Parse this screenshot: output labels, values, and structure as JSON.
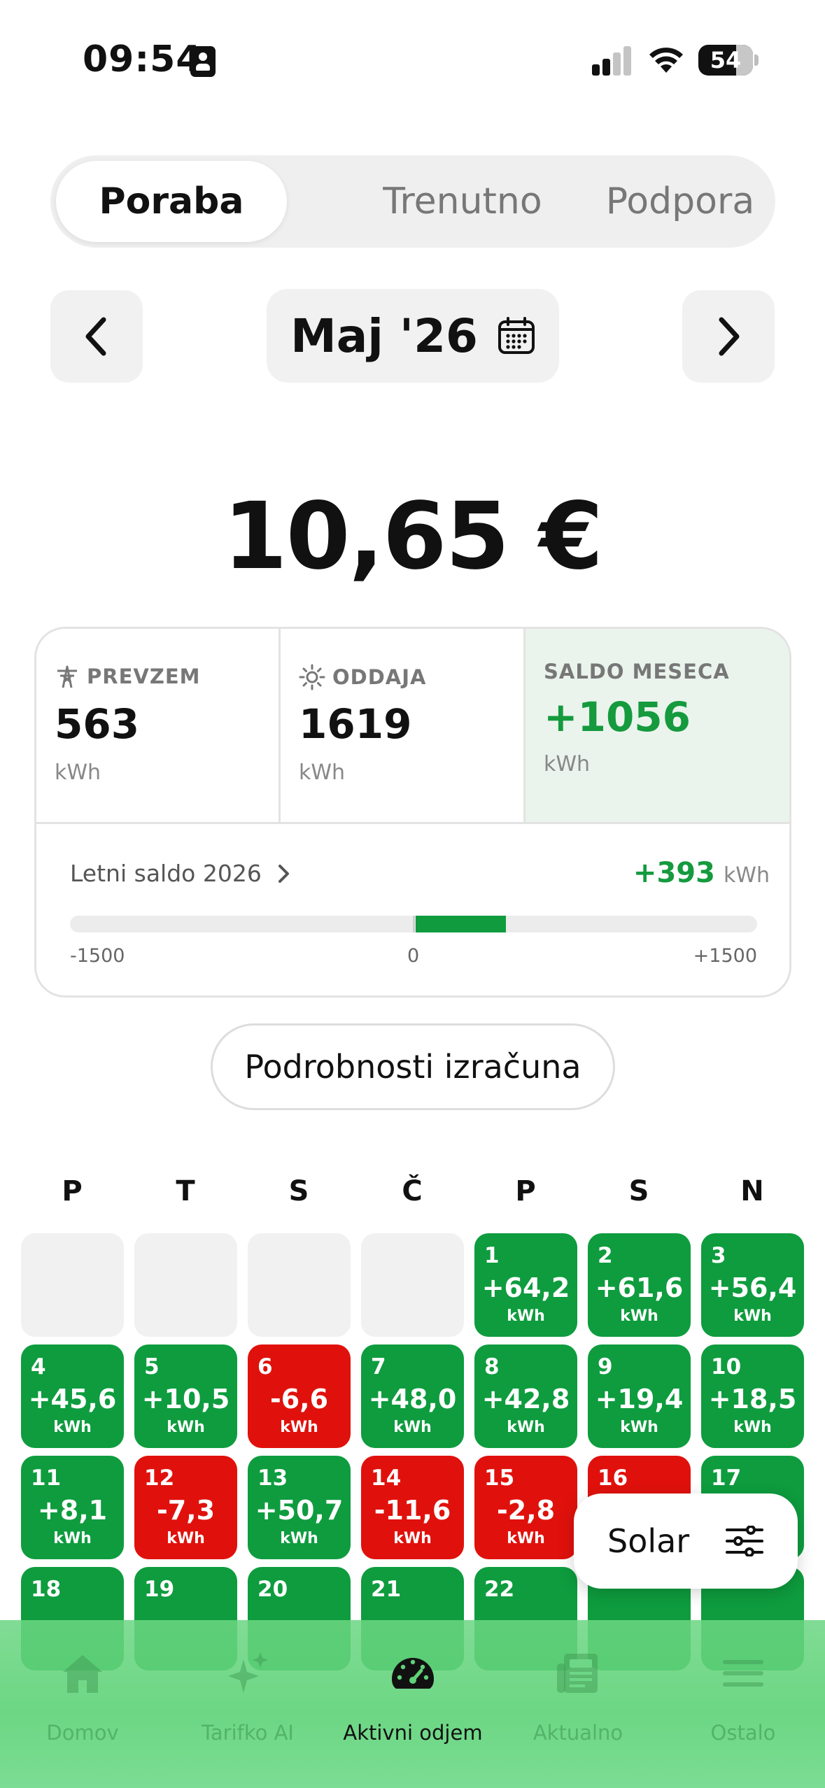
{
  "status_bar": {
    "time": "09:54",
    "battery": "54"
  },
  "tabs": [
    {
      "label": "Poraba",
      "active": true
    },
    {
      "label": "Trenutno",
      "active": false
    },
    {
      "label": "Podpora",
      "active": false
    }
  ],
  "period": {
    "label": "Maj '26"
  },
  "total": "10,65 €",
  "stats": {
    "prevzem": {
      "label": "PREVZEM",
      "value": "563",
      "unit": "kWh"
    },
    "oddaja": {
      "label": "ODDAJA",
      "value": "1619",
      "unit": "kWh"
    },
    "saldo": {
      "label": "SALDO MESECA",
      "value": "+1056",
      "unit": "kWh"
    }
  },
  "yearly": {
    "label": "Letni saldo 2026",
    "value": "+393",
    "unit": "kWh",
    "value_num": 393,
    "scale_min": -1500,
    "scale_max": 1500,
    "tick_min": "-1500",
    "tick_zero": "0",
    "tick_max": "+1500"
  },
  "details_button": "Podrobnosti izračuna",
  "calendar": {
    "weekdays": [
      "P",
      "T",
      "S",
      "Č",
      "P",
      "S",
      "N"
    ],
    "unit": "kWh",
    "days": [
      {
        "day": "1",
        "value": "+64,2",
        "type": "pos"
      },
      {
        "day": "2",
        "value": "+61,6",
        "type": "pos"
      },
      {
        "day": "3",
        "value": "+56,4",
        "type": "pos"
      },
      {
        "day": "4",
        "value": "+45,6",
        "type": "pos"
      },
      {
        "day": "5",
        "value": "+10,5",
        "type": "pos"
      },
      {
        "day": "6",
        "value": "-6,6",
        "type": "neg"
      },
      {
        "day": "7",
        "value": "+48,0",
        "type": "pos"
      },
      {
        "day": "8",
        "value": "+42,8",
        "type": "pos"
      },
      {
        "day": "9",
        "value": "+19,4",
        "type": "pos"
      },
      {
        "day": "10",
        "value": "+18,5",
        "type": "pos"
      },
      {
        "day": "11",
        "value": "+8,1",
        "type": "pos"
      },
      {
        "day": "12",
        "value": "-7,3",
        "type": "neg"
      },
      {
        "day": "13",
        "value": "+50,7",
        "type": "pos"
      },
      {
        "day": "14",
        "value": "-11,6",
        "type": "neg"
      },
      {
        "day": "15",
        "value": "-2,8",
        "type": "neg"
      },
      {
        "day": "16",
        "value": "",
        "type": "neg"
      },
      {
        "day": "17",
        "value": "",
        "type": "pos"
      },
      {
        "day": "18",
        "value": "",
        "type": "pos"
      },
      {
        "day": "19",
        "value": "",
        "type": "pos"
      },
      {
        "day": "20",
        "value": "",
        "type": "pos"
      },
      {
        "day": "21",
        "value": "",
        "type": "pos"
      },
      {
        "day": "22",
        "value": "",
        "type": "pos"
      },
      {
        "day": "",
        "value": "",
        "type": "pos"
      },
      {
        "day": "",
        "value": "",
        "type": "pos"
      }
    ]
  },
  "solar_button": "Solar",
  "nav": [
    {
      "label": "Domov",
      "icon": "home-icon",
      "active": false
    },
    {
      "label": "Tarifko AI",
      "icon": "sparkles-icon",
      "active": false
    },
    {
      "label": "Aktivni odjem",
      "icon": "speedometer-icon",
      "active": true
    },
    {
      "label": "Aktualno",
      "icon": "newspaper-icon",
      "active": false
    },
    {
      "label": "Ostalo",
      "icon": "menu-icon",
      "active": false
    }
  ],
  "colors": {
    "positive": "#0e9c3e",
    "negative": "#e0110c",
    "accent_text": "#159a3e"
  }
}
